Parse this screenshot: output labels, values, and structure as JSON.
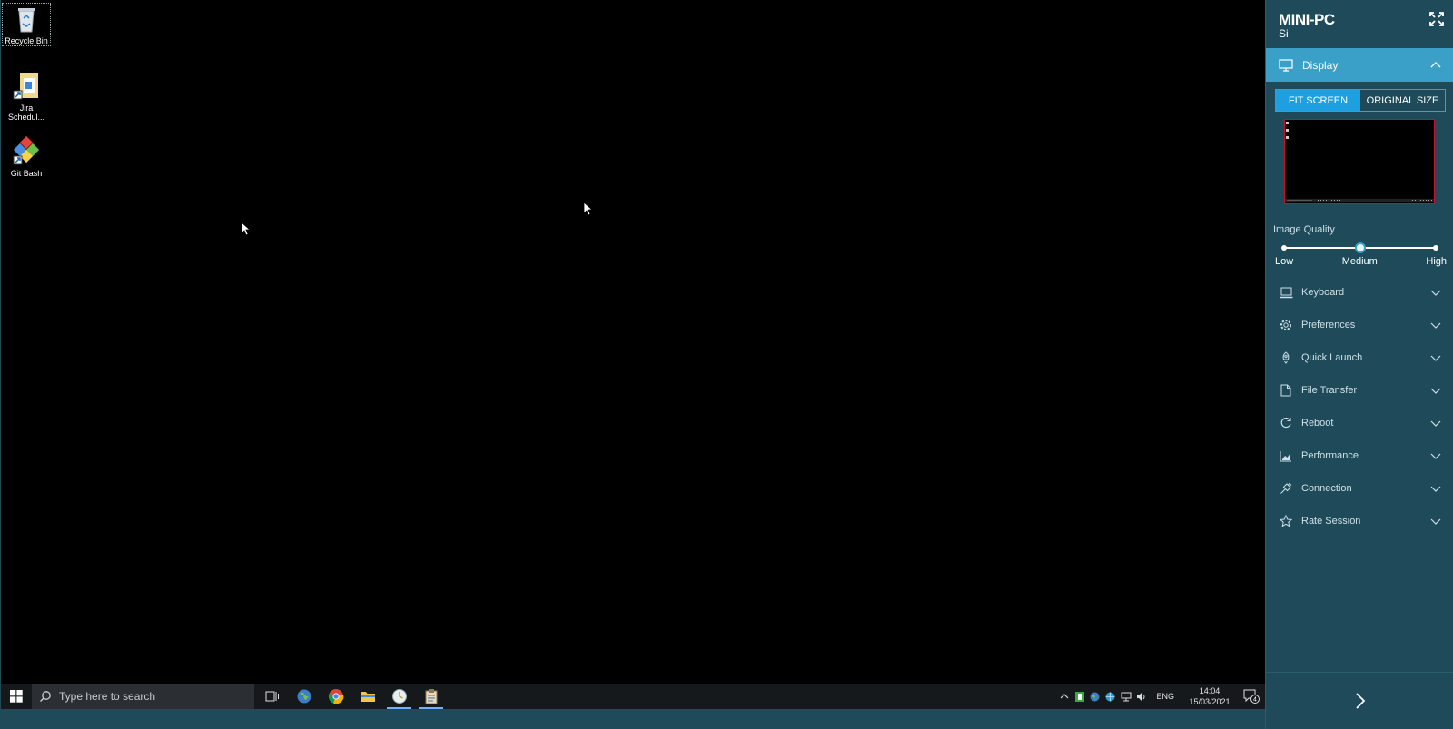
{
  "desktop": {
    "icons": [
      {
        "label": "Recycle Bin"
      },
      {
        "label": "Jira Schedul..."
      },
      {
        "label": "Git Bash"
      }
    ]
  },
  "taskbar": {
    "search_placeholder": "Type here to search",
    "apps": [
      "task-view",
      "browser-globe",
      "chrome",
      "file-explorer",
      "clock-app",
      "notes-app"
    ],
    "tray": {
      "language": "ENG",
      "time": "14:04",
      "date": "15/03/2021",
      "notification_count": "4"
    }
  },
  "panel": {
    "device_name": "MINI-PC",
    "device_subtitle": "Si",
    "display": {
      "label": "Display",
      "fit_screen": "FIT SCREEN",
      "original_size": "ORIGINAL SIZE",
      "image_quality_label": "Image Quality",
      "quality_low": "Low",
      "quality_medium": "Medium",
      "quality_high": "High",
      "quality_level_fraction": 0.5
    },
    "menu": [
      {
        "label": "Keyboard",
        "icon": "laptop-icon"
      },
      {
        "label": "Preferences",
        "icon": "gear-icon"
      },
      {
        "label": "Quick Launch",
        "icon": "rocket-icon"
      },
      {
        "label": "File Transfer",
        "icon": "file-icon"
      },
      {
        "label": "Reboot",
        "icon": "reboot-icon"
      },
      {
        "label": "Performance",
        "icon": "chart-icon"
      },
      {
        "label": "Connection",
        "icon": "plug-icon"
      },
      {
        "label": "Rate Session",
        "icon": "star-icon"
      }
    ]
  },
  "colors": {
    "panel_bg": "#1e4a5a",
    "accent": "#3aa0c8",
    "button_active": "#1ea0e0",
    "preview_border": "#c8102e"
  }
}
